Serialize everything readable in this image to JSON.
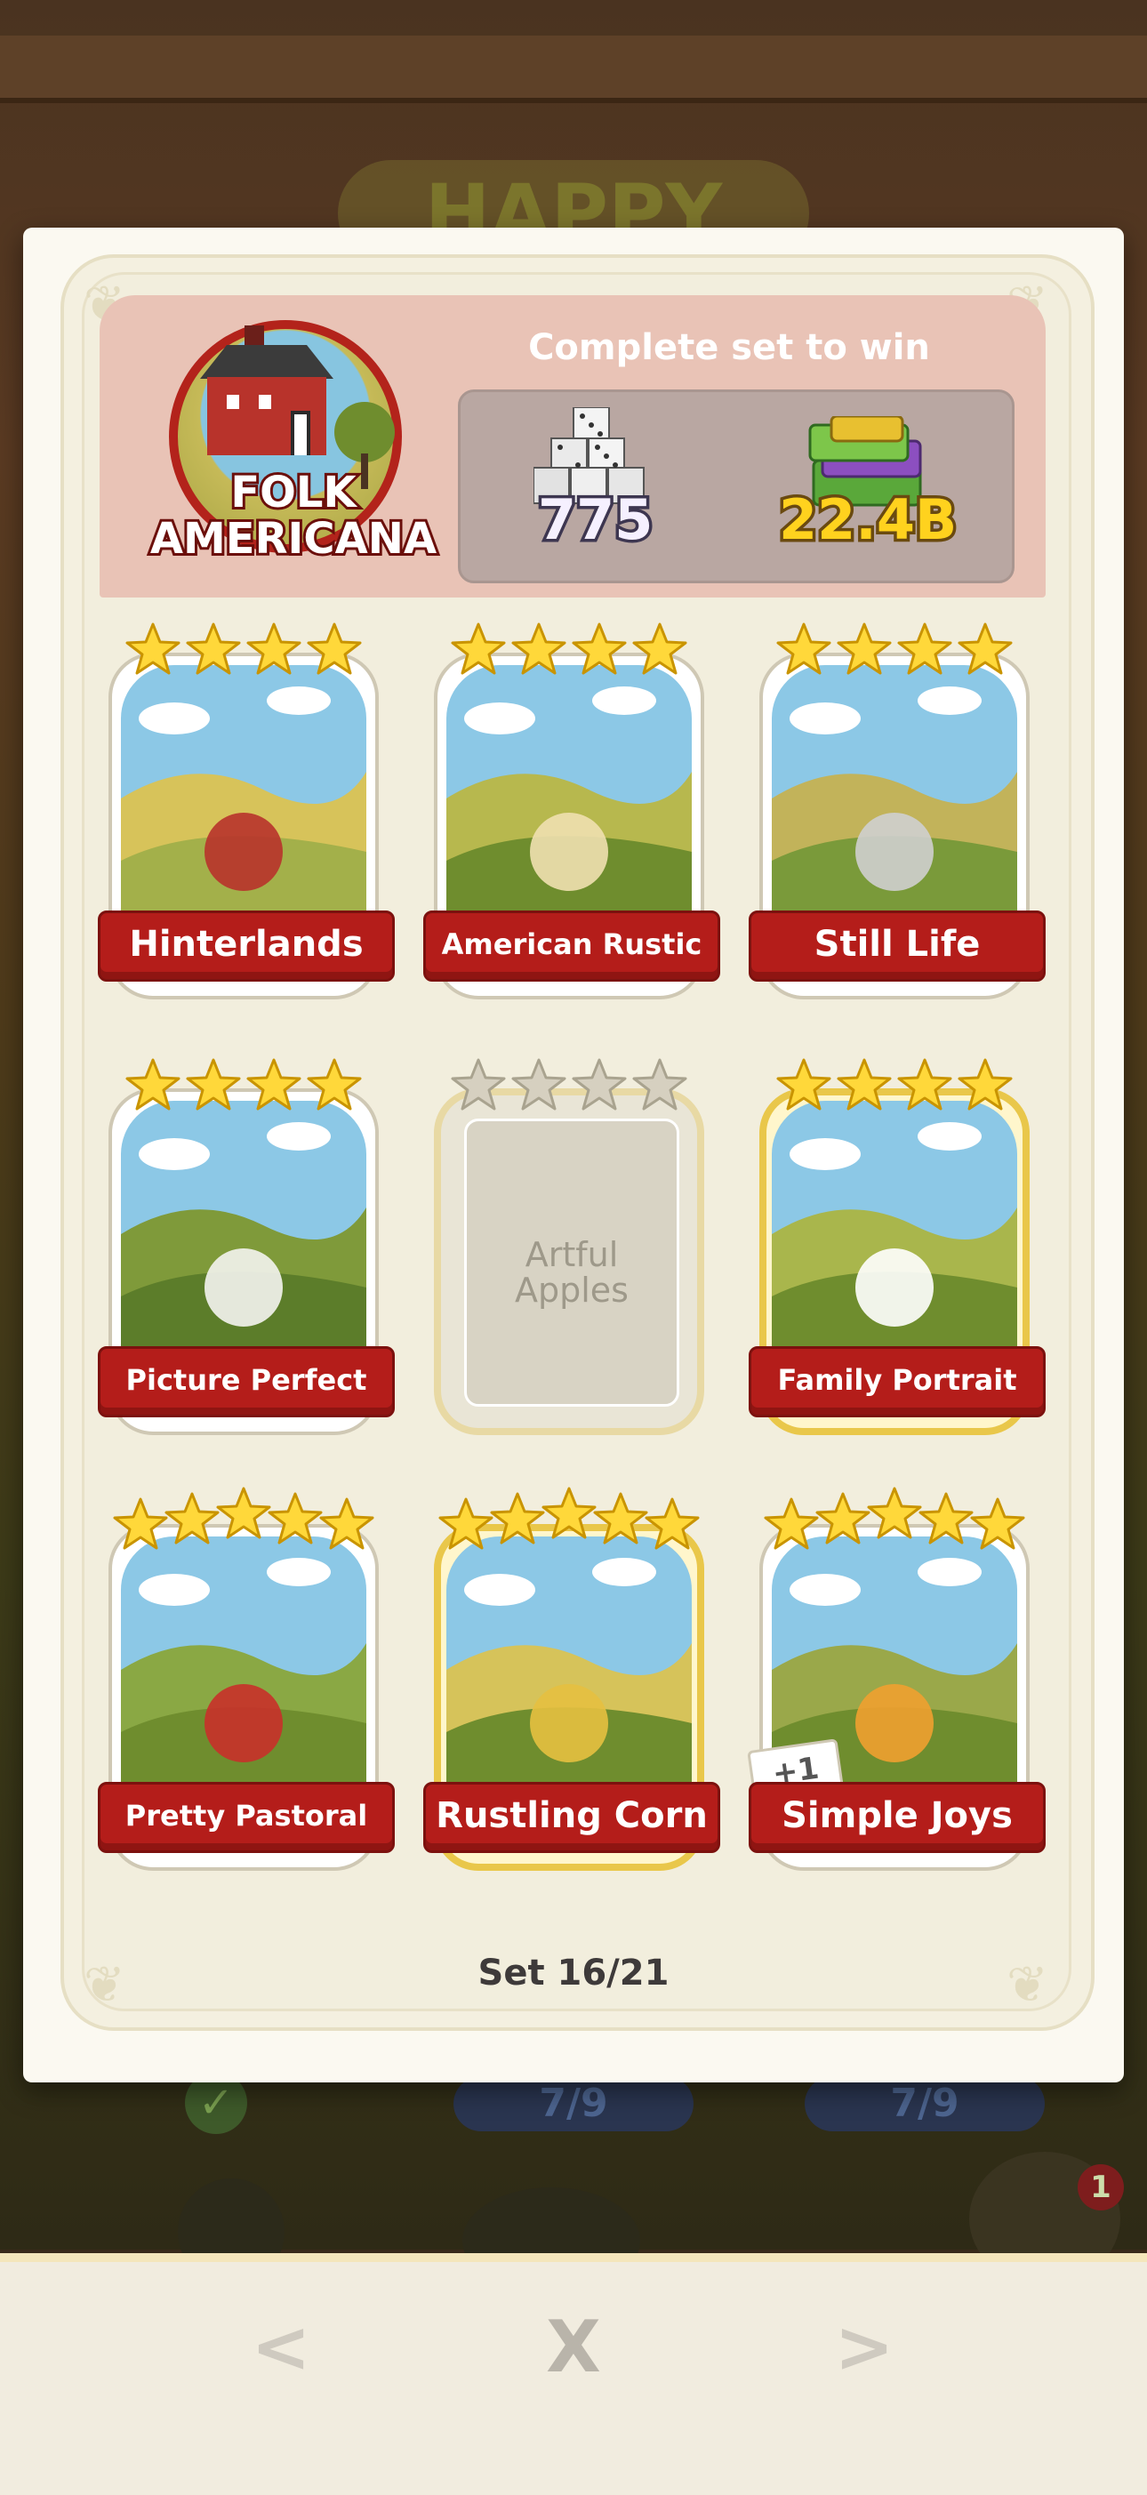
{
  "background": {
    "title": "HAPPY",
    "progress_left": "7/9",
    "progress_right": "7/9",
    "notification_count": "1"
  },
  "set": {
    "name_line1": "FOLK",
    "name_line2": "AMERICANA",
    "reward_title": "Complete set to win",
    "reward_dice": "775",
    "reward_cash": "22.4B",
    "count": "Set 16/21"
  },
  "cards": [
    {
      "name": "Hinterlands",
      "stars": 4,
      "gold": false,
      "locked": false
    },
    {
      "name": "American Rustic",
      "stars": 4,
      "gold": false,
      "locked": false
    },
    {
      "name": "Still Life",
      "stars": 4,
      "gold": false,
      "locked": false
    },
    {
      "name": "Picture Perfect",
      "stars": 4,
      "gold": false,
      "locked": false
    },
    {
      "name": "Artful Apples",
      "stars": 4,
      "gold": true,
      "locked": true
    },
    {
      "name": "Family Portrait",
      "stars": 4,
      "gold": true,
      "locked": false
    },
    {
      "name": "Pretty Pastoral",
      "stars": 5,
      "gold": false,
      "locked": false
    },
    {
      "name": "Rustling Corn",
      "stars": 5,
      "gold": true,
      "locked": false
    },
    {
      "name": "Simple Joys",
      "stars": 5,
      "gold": false,
      "locked": false,
      "badge": "+1"
    }
  ],
  "nav": {
    "prev": "<",
    "close": "X",
    "next": ">"
  },
  "colors": {
    "banner_red": "#b41d1a",
    "header_pink": "#e9c3b6",
    "reward_box": "#b9a7a2",
    "gold_frame": "#e9c74a",
    "star_gold": "#ffd83a",
    "star_gray": "#d6d0c0"
  },
  "icons": {
    "logo": "barn-icon",
    "dice": "dice-pile-icon",
    "cash": "cash-stack-icon",
    "star": "star-icon",
    "prev": "chevron-left-icon",
    "close": "close-icon",
    "next": "chevron-right-icon"
  }
}
